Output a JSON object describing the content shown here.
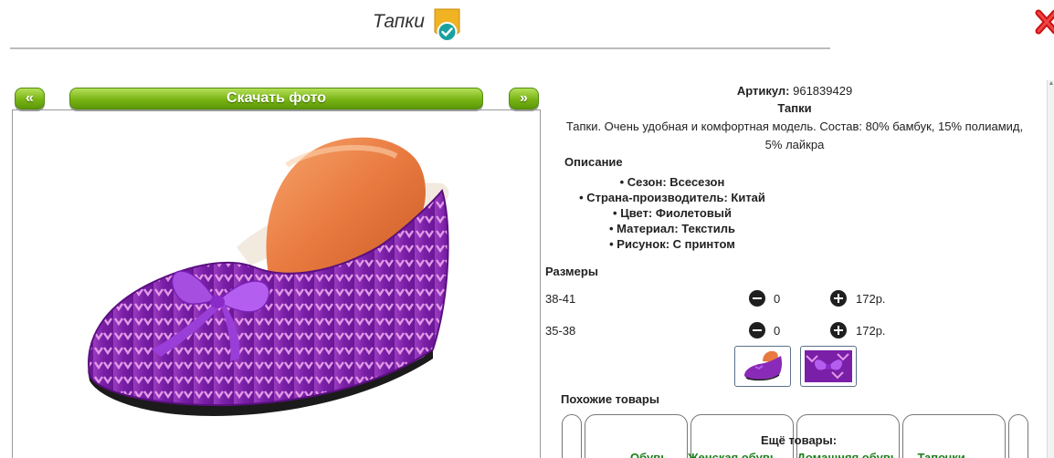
{
  "header": {
    "title": "Тапки",
    "badge_icon": "check-badge-icon",
    "close_icon": "close-icon",
    "badge_color": "#f0b323",
    "close_color": "#cc1111"
  },
  "gallery": {
    "prev_label": "«",
    "next_label": "»",
    "download_label": "Скачать фото",
    "button_color": "#78b414"
  },
  "product": {
    "article_label": "Артикул:",
    "article_value": "961839429",
    "name": "Тапки",
    "description_line1": "Тапки. Очень удобная и комфортная модель. Состав: 80% бамбук, 15% полиамид,",
    "description_line2": "5% лайкра",
    "details_title": "Описание",
    "details": [
      "• Сезон: Всесезон",
      "• Страна-производитель: Китай",
      "• Цвет: Фиолетовый",
      "• Материал: Текстиль",
      "• Рисунок: С принтом"
    ]
  },
  "sizes": {
    "title": "Размеры",
    "rows": [
      {
        "name": "38-41",
        "qty": "0",
        "price": "172р."
      },
      {
        "name": "35-38",
        "qty": "0",
        "price": "172р."
      }
    ]
  },
  "thumbnails": [
    {
      "icon": "slipper-thumbnail"
    },
    {
      "icon": "bow-closeup-thumbnail"
    }
  ],
  "similar": {
    "title": "Похожие товары"
  },
  "more": {
    "title": "Ещё товары:",
    "links": [
      "Обувь",
      "Женская обувь",
      "Домашняя обувь",
      "Тапочки"
    ],
    "link_color": "#1a7f1a"
  }
}
